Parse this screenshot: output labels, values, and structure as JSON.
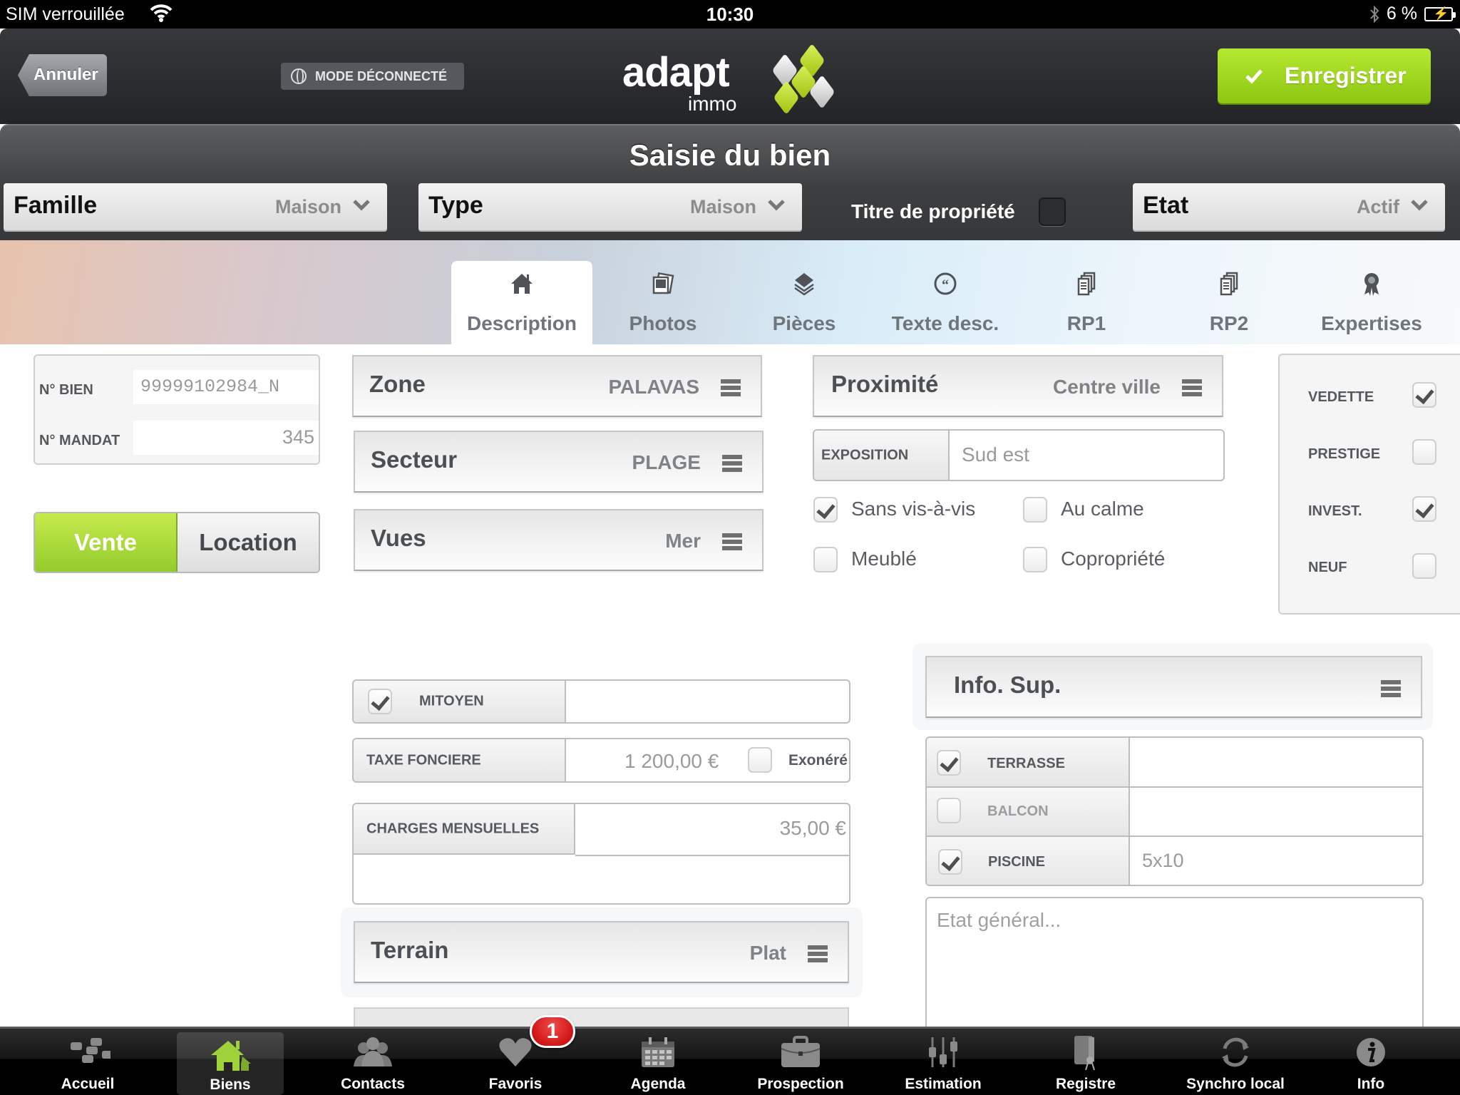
{
  "status_bar": {
    "carrier": "SIM verrouillée",
    "time": "10:30",
    "battery": "6 %"
  },
  "header": {
    "cancel_label": "Annuler",
    "offline_label": "MODE DÉCONNECTÉ",
    "logo_word": "adapt",
    "logo_sub": "immo",
    "save_label": "Enregistrer",
    "accent_color": "#9fd61e"
  },
  "title_band": {
    "title": "Saisie du bien",
    "famille": {
      "label": "Famille",
      "value": "Maison"
    },
    "type": {
      "label": "Type",
      "value": "Maison"
    },
    "title_deed": {
      "label": "Titre de propriété",
      "checked": false
    },
    "etat": {
      "label": "Etat",
      "value": "Actif"
    }
  },
  "tabs": [
    {
      "label": "Description",
      "icon": "home-icon",
      "active": true
    },
    {
      "label": "Photos",
      "icon": "photos-icon",
      "active": false
    },
    {
      "label": "Pièces",
      "icon": "layers-icon",
      "active": false
    },
    {
      "label": "Texte desc.",
      "icon": "quote-icon",
      "active": false
    },
    {
      "label": "RP1",
      "icon": "documents-icon",
      "active": false
    },
    {
      "label": "RP2",
      "icon": "documents-icon",
      "active": false
    },
    {
      "label": "Expertises",
      "icon": "award-icon",
      "active": false
    }
  ],
  "ids": {
    "bien_label": "N° BIEN",
    "bien_value": "99999102984_N",
    "mandat_label": "N° MANDAT",
    "mandat_value": "345"
  },
  "transaction": {
    "options": [
      "Vente",
      "Location"
    ],
    "selected": "Vente"
  },
  "pickers": {
    "zone": {
      "label": "Zone",
      "value": "PALAVAS"
    },
    "secteur": {
      "label": "Secteur",
      "value": "PLAGE"
    },
    "vues": {
      "label": "Vues",
      "value": "Mer"
    },
    "proximite": {
      "label": "Proximité",
      "value": "Centre ville"
    },
    "terrain": {
      "label": "Terrain",
      "value": "Plat"
    },
    "info_sup": {
      "label": "Info. Sup.",
      "value": ""
    }
  },
  "exposition": {
    "label": "EXPOSITION",
    "value": "Sud est"
  },
  "features": [
    {
      "label": "Sans vis-à-vis",
      "checked": true
    },
    {
      "label": "Au calme",
      "checked": false
    },
    {
      "label": "Meublé",
      "checked": false
    },
    {
      "label": "Copropriété",
      "checked": false
    }
  ],
  "flags": [
    {
      "label": "VEDETTE",
      "checked": true
    },
    {
      "label": "PRESTIGE",
      "checked": false
    },
    {
      "label": "INVEST.",
      "checked": true
    },
    {
      "label": "NEUF",
      "checked": false
    }
  ],
  "finance": {
    "mitoyen": {
      "label": "MITOYEN",
      "checked": true,
      "value": ""
    },
    "taxe_fonciere": {
      "label": "TAXE FONCIERE",
      "value": "1 200,00 €",
      "exonere_label": "Exonéré",
      "exonere_checked": false
    },
    "charges": {
      "label": "CHARGES MENSUELLES",
      "value": "35,00 €",
      "note": ""
    }
  },
  "amenities": [
    {
      "label": "TERRASSE",
      "checked": true,
      "value": ""
    },
    {
      "label": "BALCON",
      "checked": false,
      "value": ""
    },
    {
      "label": "PISCINE",
      "checked": true,
      "value": "5x10"
    }
  ],
  "etat_general": {
    "placeholder": "Etat général...",
    "value": ""
  },
  "bottom_tabs": [
    {
      "label": "Accueil",
      "icon": "home-tiles-icon",
      "active": false
    },
    {
      "label": "Biens",
      "icon": "house-icon",
      "active": true
    },
    {
      "label": "Contacts",
      "icon": "contacts-icon",
      "active": false
    },
    {
      "label": "Favoris",
      "icon": "heart-icon",
      "active": false,
      "badge": "1"
    },
    {
      "label": "Agenda",
      "icon": "calendar-icon",
      "active": false
    },
    {
      "label": "Prospection",
      "icon": "briefcase-icon",
      "active": false
    },
    {
      "label": "Estimation",
      "icon": "sliders-icon",
      "active": false
    },
    {
      "label": "Registre",
      "icon": "certificate-icon",
      "active": false
    },
    {
      "label": "Synchro local",
      "icon": "sync-icon",
      "active": false
    },
    {
      "label": "Info",
      "icon": "info-icon",
      "active": false
    }
  ]
}
